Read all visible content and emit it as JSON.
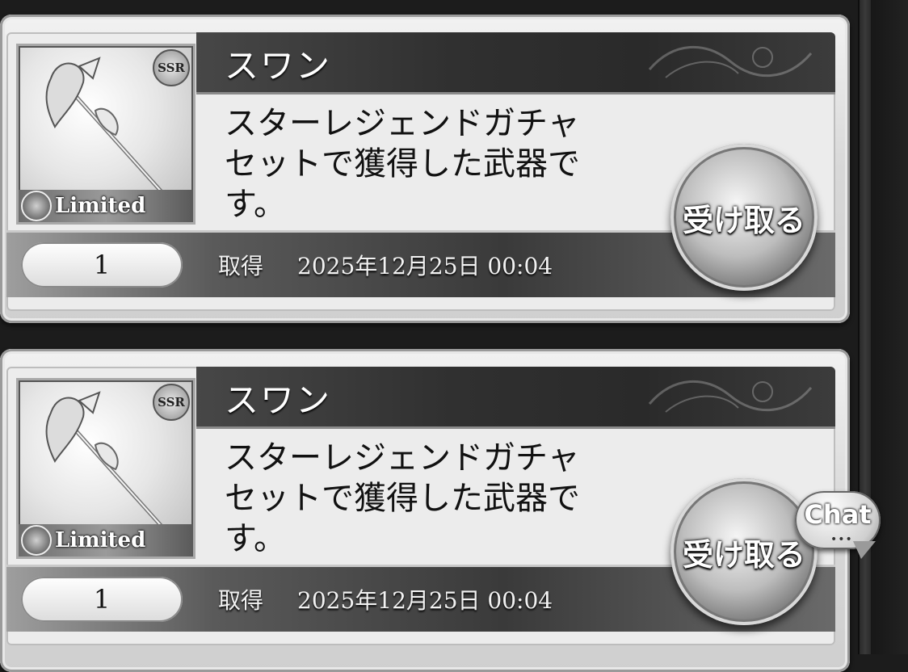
{
  "items": [
    {
      "name": "スワン",
      "rarity": "SSR",
      "tag": "Limited",
      "description_lines": [
        "スターレジェンドガチャ",
        "セットで獲得した武器で",
        "す。"
      ],
      "quantity": "1",
      "acquired_label": "取得",
      "acquired_date": "2025年12月25日 00:04",
      "receive_label": "受け取る"
    },
    {
      "name": "スワン",
      "rarity": "SSR",
      "tag": "Limited",
      "description_lines": [
        "スターレジェンドガチャ",
        "セットで獲得した武器で",
        "す。"
      ],
      "quantity": "1",
      "acquired_label": "取得",
      "acquired_date": "2025年12月25日 00:04",
      "receive_label": "受け取る"
    }
  ],
  "chat": {
    "label": "Chat",
    "dots": "•••"
  },
  "icons": {
    "weapon": "spear-axe-icon",
    "limited": "swan-emblem-icon",
    "chat": "chat-bubble-icon"
  }
}
